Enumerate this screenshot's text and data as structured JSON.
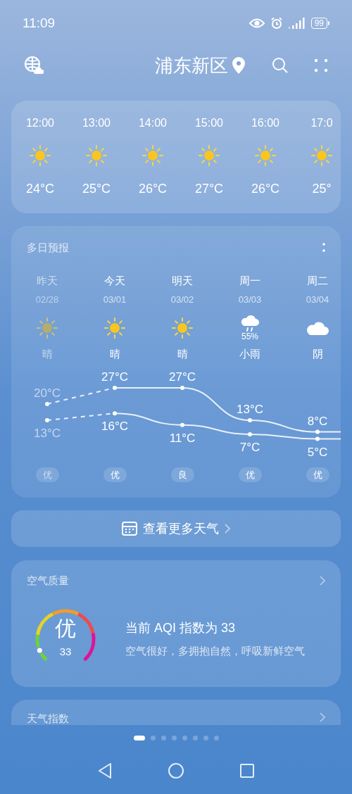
{
  "status_bar": {
    "time": "11:09",
    "battery": "99"
  },
  "header": {
    "location": "浦东新区"
  },
  "hourly": [
    {
      "time": "12:00",
      "kind": "sunny",
      "temp": "24°C"
    },
    {
      "time": "13:00",
      "kind": "sunny",
      "temp": "25°C"
    },
    {
      "time": "14:00",
      "kind": "sunny",
      "temp": "26°C"
    },
    {
      "time": "15:00",
      "kind": "sunny",
      "temp": "27°C"
    },
    {
      "time": "16:00",
      "kind": "sunny",
      "temp": "26°C"
    },
    {
      "time": "17:0",
      "kind": "sunny",
      "temp": "25°"
    }
  ],
  "forecast": {
    "title": "多日预报",
    "days": [
      {
        "name": "昨天",
        "date": "02/28",
        "kind": "sunny",
        "condition": "晴",
        "high": "20°C",
        "low": "13°C",
        "aqi": "优",
        "past": true
      },
      {
        "name": "今天",
        "date": "03/01",
        "kind": "sunny",
        "condition": "晴",
        "high": "27°C",
        "low": "16°C",
        "aqi": "优",
        "past": false
      },
      {
        "name": "明天",
        "date": "03/02",
        "kind": "sunny",
        "condition": "晴",
        "high": "27°C",
        "low": "11°C",
        "aqi": "良",
        "past": false
      },
      {
        "name": "周一",
        "date": "03/03",
        "kind": "rain",
        "precip": "55%",
        "condition": "小雨",
        "high": "13°C",
        "low": "7°C",
        "aqi": "优",
        "past": false
      },
      {
        "name": "周二",
        "date": "03/04",
        "kind": "cloudy",
        "condition": "阴",
        "high": "8°C",
        "low": "5°C",
        "aqi": "优",
        "past": false
      }
    ]
  },
  "more_button": {
    "label": "查看更多天气"
  },
  "air_quality": {
    "title": "空气质量",
    "grade": "优",
    "value": "33",
    "level": 0.08,
    "headline": "当前 AQI 指数为 33",
    "advice": "空气很好，多拥抱自然，呼吸新鲜空气"
  },
  "weather_index": {
    "title": "天气指数"
  },
  "pages": [
    {
      "selected": true
    },
    {
      "selected": false
    },
    {
      "selected": false
    },
    {
      "selected": false
    },
    {
      "selected": false
    },
    {
      "selected": false
    },
    {
      "selected": false
    },
    {
      "selected": false
    }
  ]
}
